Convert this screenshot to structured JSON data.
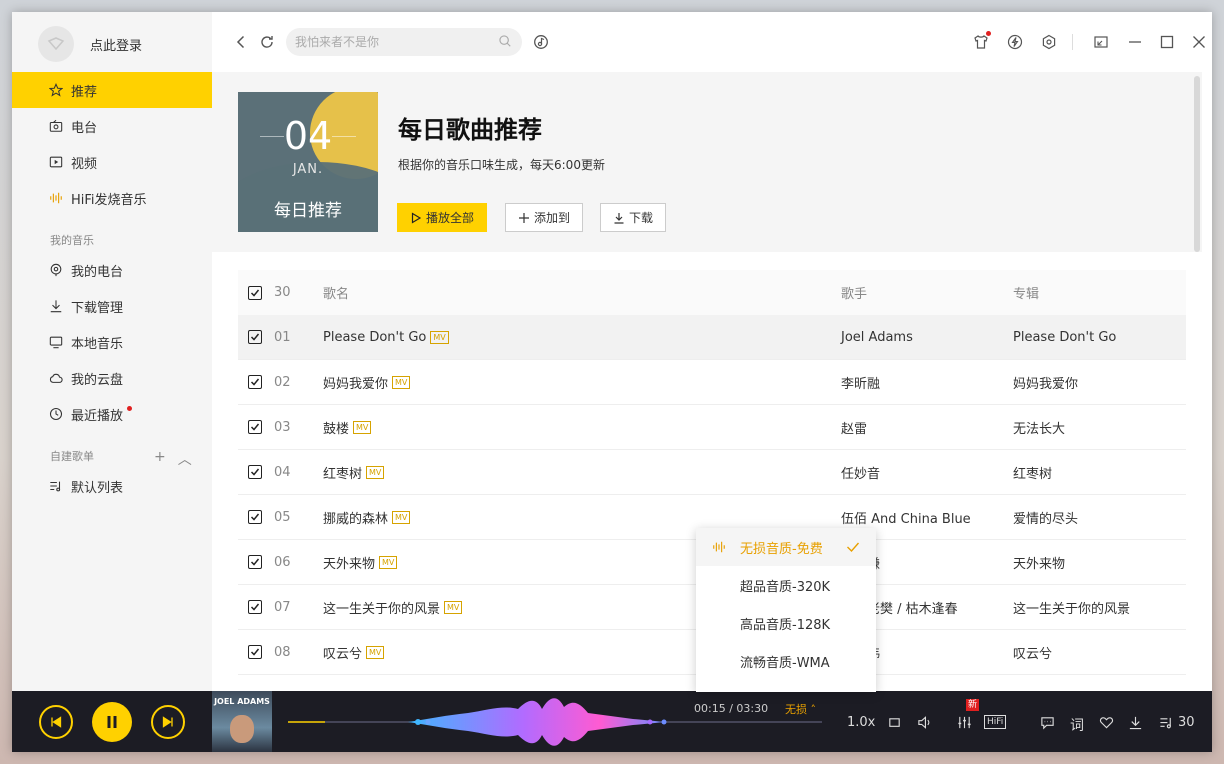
{
  "sidebar": {
    "login": "点此登录",
    "nav": [
      {
        "label": "推荐",
        "icon": "star-icon",
        "active": true
      },
      {
        "label": "电台",
        "icon": "radio-icon"
      },
      {
        "label": "视频",
        "icon": "video-icon"
      },
      {
        "label": "HiFi发烧音乐",
        "icon": "hifi-wave-icon"
      }
    ],
    "my_music_title": "我的音乐",
    "my_music": [
      {
        "label": "我的电台",
        "icon": "podcast-icon"
      },
      {
        "label": "下载管理",
        "icon": "download-icon"
      },
      {
        "label": "本地音乐",
        "icon": "monitor-icon"
      },
      {
        "label": "我的云盘",
        "icon": "cloud-icon"
      },
      {
        "label": "最近播放",
        "icon": "clock-icon",
        "dot": true
      }
    ],
    "playlist_title": "自建歌单",
    "playlists": [
      {
        "label": "默认列表",
        "icon": "playlist-icon"
      }
    ]
  },
  "topbar": {
    "search_placeholder": "我怕来者不是你"
  },
  "hero": {
    "cover_day": "04",
    "cover_month": "JAN.",
    "cover_title": "每日推荐",
    "title": "每日歌曲推荐",
    "subtitle": "根据你的音乐口味生成，每天6:00更新",
    "play_all": "播放全部",
    "add_to": "添加到",
    "download": "下载"
  },
  "table": {
    "count": "30",
    "col_song": "歌名",
    "col_artist": "歌手",
    "col_album": "专辑",
    "mv_label": "MV",
    "rows": [
      {
        "num": "01",
        "song": "Please Don't Go",
        "artist": "Joel Adams",
        "album": "Please Don't Go"
      },
      {
        "num": "02",
        "song": "妈妈我爱你",
        "artist": "李昕融",
        "album": "妈妈我爱你"
      },
      {
        "num": "03",
        "song": "鼓楼",
        "artist": "赵雷",
        "album": "无法长大"
      },
      {
        "num": "04",
        "song": "红枣树",
        "artist": "任妙音",
        "album": "红枣树"
      },
      {
        "num": "05",
        "song": "挪威的森林",
        "artist": "伍佰 And China Blue",
        "album": "爱情的尽头"
      },
      {
        "num": "06",
        "song": "天外来物",
        "artist": "薛之谦",
        "album": "天外来物"
      },
      {
        "num": "07",
        "song": "这一生关于你的风景",
        "artist": "隔壁老樊 / 枯木逢春",
        "album": "这一生关于你的风景"
      },
      {
        "num": "08",
        "song": "叹云兮",
        "artist": "鞠婧祎",
        "album": "叹云兮"
      }
    ]
  },
  "quality_menu": {
    "items": [
      "无损音质-免费",
      "超品音质-320K",
      "高品音质-128K",
      "流畅音质-WMA"
    ],
    "selected": 0
  },
  "player": {
    "thumb_text": "JOEL ADAMS",
    "time": "00:15 / 03:30",
    "quality": "无损",
    "speed": "1.0x",
    "new_badge": "新",
    "hifi": "HiFi",
    "lyric": "词",
    "list_count": "30",
    "progress": 0.07,
    "accent": "#ffd100"
  }
}
